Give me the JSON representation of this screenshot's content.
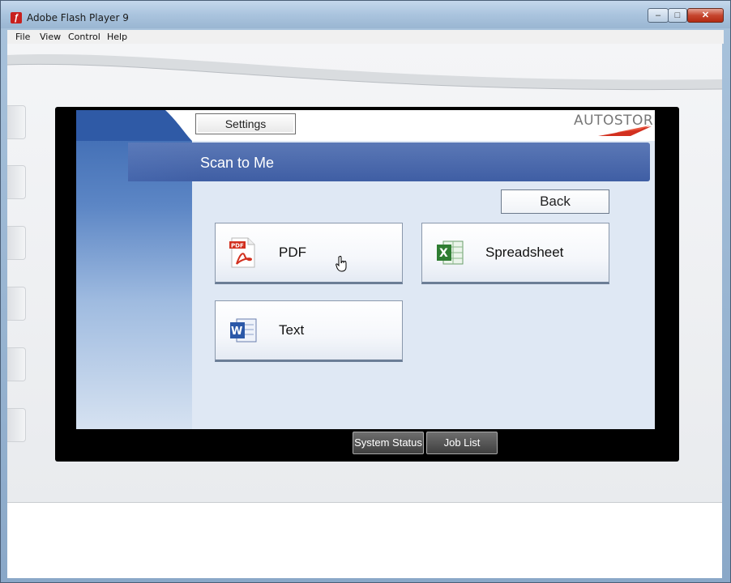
{
  "window": {
    "title": "Adobe Flash Player 9",
    "controls": {
      "minimize": "–",
      "maximize": "□",
      "close": "✕"
    }
  },
  "menubar": {
    "items": [
      "File",
      "View",
      "Control",
      "Help"
    ]
  },
  "panel": {
    "settings_label": "Settings",
    "logo_text": "AUTOSTORE",
    "header_title": "Scan to Me",
    "back_label": "Back",
    "formats": [
      {
        "label": "PDF",
        "icon": "pdf-icon"
      },
      {
        "label": "Spreadsheet",
        "icon": "excel-icon"
      },
      {
        "label": "Text",
        "icon": "word-icon"
      }
    ],
    "bottom_buttons": [
      "System Status",
      "Job List"
    ]
  },
  "colors": {
    "header_bar": "#4a68ac",
    "accent_red": "#d2301f",
    "screen_bg": "#dfe8f4"
  }
}
